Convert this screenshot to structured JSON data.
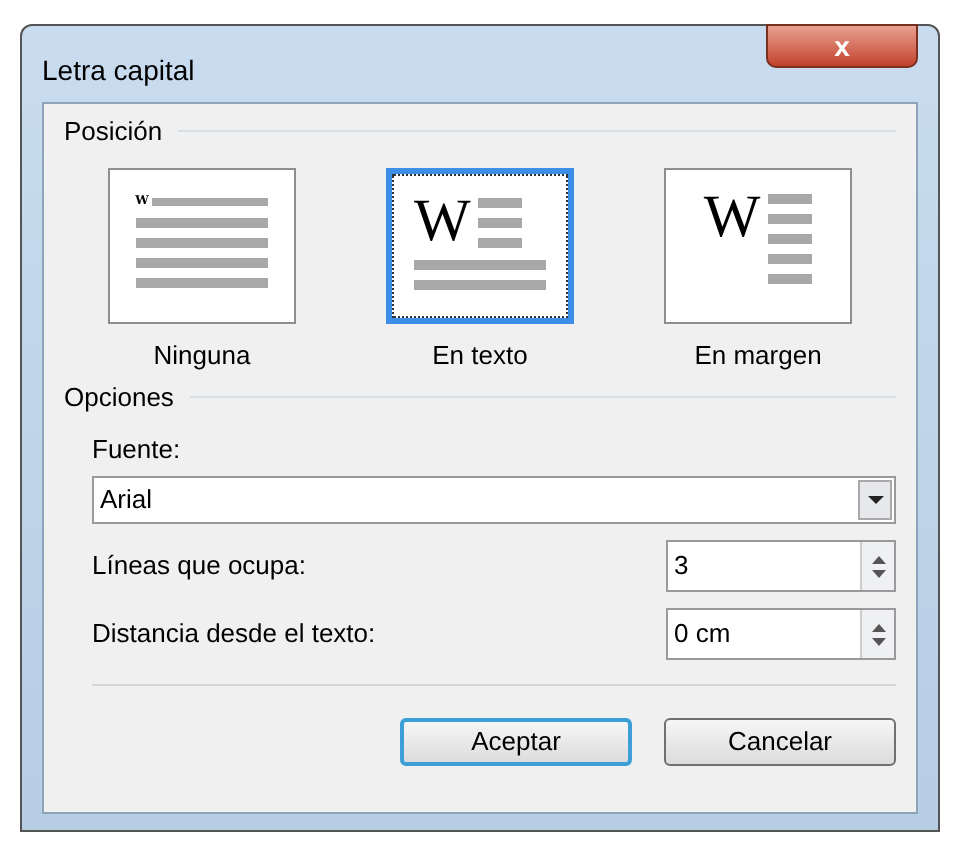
{
  "window": {
    "title": "Letra capital",
    "close_label": "x"
  },
  "position": {
    "heading": "Posición",
    "options": [
      {
        "kind": "none",
        "label": "Ninguna",
        "selected": false,
        "glyph": "W"
      },
      {
        "kind": "in_text",
        "label": "En texto",
        "selected": true,
        "glyph": "W"
      },
      {
        "kind": "margin",
        "label": "En margen",
        "selected": false,
        "glyph": "W"
      }
    ]
  },
  "options": {
    "heading": "Opciones",
    "font_label": "Fuente:",
    "font_value": "Arial",
    "fields": [
      {
        "label": "Líneas que ocupa:",
        "value": "3"
      },
      {
        "label": "Distancia desde el texto:",
        "value": "0 cm"
      }
    ]
  },
  "buttons": [
    {
      "label": "Aceptar",
      "default": true
    },
    {
      "label": "Cancelar",
      "default": false
    }
  ]
}
